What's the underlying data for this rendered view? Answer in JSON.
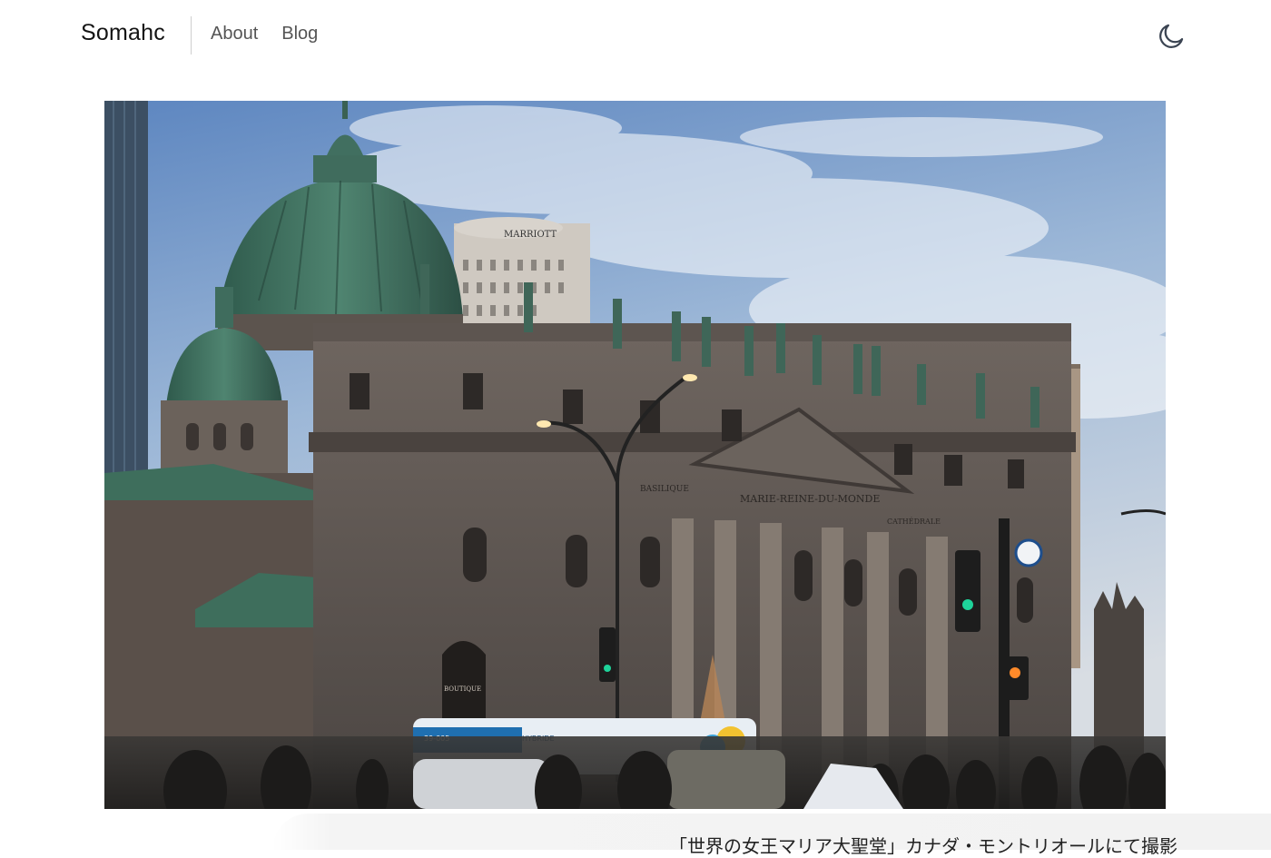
{
  "header": {
    "brand": "Somahc",
    "nav": [
      {
        "label": "About"
      },
      {
        "label": "Blog"
      }
    ],
    "theme_toggle_icon": "moon-icon"
  },
  "photo": {
    "sign_basilique": "BASILIQUE",
    "sign_main": "MARIE-REINE-DU-MONDE",
    "sign_cathedrale": "CATHÉDRALE",
    "sign_boutique": "BOUTIQUE",
    "hotel_sign": "MARRIOTT",
    "bus_number": "39-005",
    "bus_brand": "HYBRIDE"
  },
  "caption": "「世界の女王マリア大聖堂」カナダ・モントリオールにて撮影"
}
